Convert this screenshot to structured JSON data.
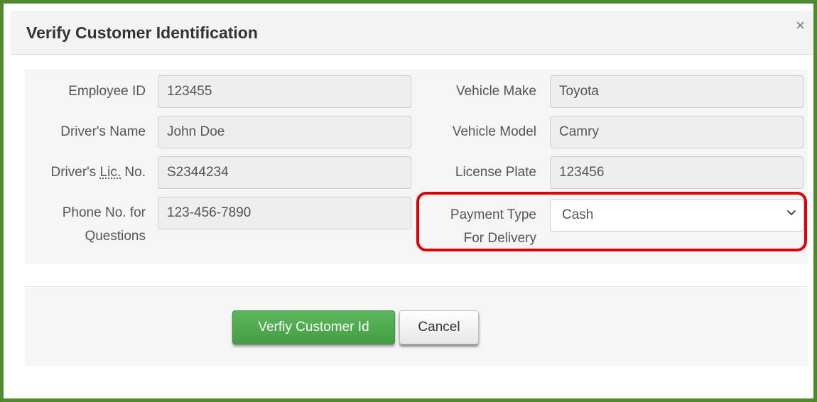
{
  "modal": {
    "title": "Verify Customer Identification",
    "close_glyph": "×",
    "close_icon": "close-icon"
  },
  "form": {
    "employee_id": {
      "label": "Employee ID",
      "value": "123455"
    },
    "drivers_name": {
      "label": "Driver's Name",
      "value": "John Doe"
    },
    "drivers_lic": {
      "label_prefix": "Driver's ",
      "label_abbr": "Lic.",
      "label_suffix": " No.",
      "value": "S2344234"
    },
    "phone": {
      "label_line1": "Phone No. for",
      "label_line2": "Questions",
      "value": "123-456-7890"
    },
    "vehicle_make": {
      "label": "Vehicle Make",
      "value": "Toyota"
    },
    "vehicle_model": {
      "label": "Vehicle Model",
      "value": "Camry"
    },
    "license_plate": {
      "label": "License Plate",
      "value": "123456"
    },
    "payment_type": {
      "label_line1": "Payment Type",
      "label_line2": "For Delivery",
      "selected": "Cash",
      "dropdown_icon": "chevron-down-icon"
    }
  },
  "buttons": {
    "verify_label": "Verfiy Customer Id",
    "cancel_label": "Cancel"
  },
  "colors": {
    "frame_border": "#4f8a31",
    "highlight": "#e00000",
    "primary_button": "#5cb85c"
  }
}
